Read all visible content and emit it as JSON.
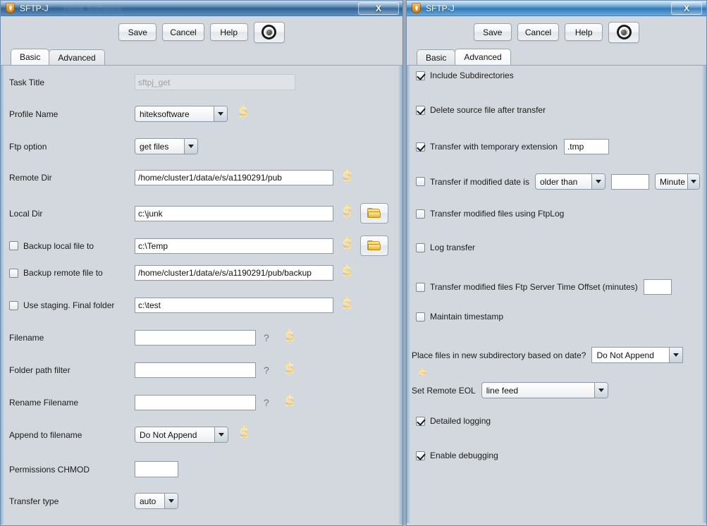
{
  "left_window": {
    "title": "SFTP-J",
    "watermark": "Hitek Software",
    "close_label": "X",
    "icon": "shield-icon",
    "toolbar": {
      "save": "Save",
      "cancel": "Cancel",
      "help": "Help",
      "settings_icon": "target-icon"
    },
    "tabs": [
      {
        "label": "Basic",
        "active": true
      },
      {
        "label": "Advanced",
        "active": false
      }
    ],
    "fields": {
      "task_title_label": "Task Title",
      "task_title_value": "sftpj_get",
      "profile_name_label": "Profile Name",
      "profile_name_value": "hiteksoftware",
      "ftp_option_label": "Ftp option",
      "ftp_option_value": "get files",
      "remote_dir_label": "Remote Dir",
      "remote_dir_value": "/home/cluster1/data/e/s/a1190291/pub",
      "local_dir_label": "Local Dir",
      "local_dir_value": "c:\\junk",
      "backup_local_label": "Backup local file to",
      "backup_local_value": "c:\\Temp",
      "backup_remote_label": "Backup remote file to",
      "backup_remote_value": "/home/cluster1/data/e/s/a1190291/pub/backup",
      "staging_label": "Use staging.  Final folder",
      "staging_value": "c:\\test",
      "filename_label": "Filename",
      "filename_value": "",
      "folder_path_filter_label": "Folder path filter",
      "folder_path_filter_value": "",
      "rename_filename_label": "Rename Filename",
      "rename_filename_value": "",
      "append_label": "Append to filename",
      "append_value": "Do Not Append",
      "chmod_label": "Permissions CHMOD",
      "chmod_value": "",
      "transfer_type_label": "Transfer type",
      "transfer_type_value": "auto",
      "help_marker": "?"
    }
  },
  "right_window": {
    "title": "SFTP-J",
    "close_label": "X",
    "icon": "shield-icon",
    "toolbar": {
      "save": "Save",
      "cancel": "Cancel",
      "help": "Help",
      "settings_icon": "target-icon"
    },
    "tabs": [
      {
        "label": "Basic",
        "active": false
      },
      {
        "label": "Advanced",
        "active": true
      }
    ],
    "options": {
      "include_subdirectories": "Include Subdirectories",
      "delete_source": "Delete source file after transfer",
      "temp_extension_label": "Transfer with temporary extension",
      "temp_extension_value": ".tmp",
      "modified_date_label": "Transfer if modified date is",
      "modified_date_compare": "older than",
      "modified_date_amount": "",
      "modified_date_unit": "Minute",
      "ftplog_label": "Transfer modified files using FtpLog",
      "log_transfer_label": "Log transfer",
      "time_offset_label": "Transfer modified files  Ftp Server Time Offset (minutes)",
      "time_offset_value": "",
      "maintain_timestamp_label": "Maintain timestamp",
      "subdirectory_date_label": "Place files in new subdirectory based on date?",
      "subdirectory_date_value": "Do Not Append",
      "remote_eol_label": "Set Remote EOL",
      "remote_eol_value": "line feed",
      "detailed_logging_label": "Detailed logging",
      "enable_debugging_label": "Enable debugging"
    }
  },
  "colors": {
    "titlebar_accent": "#3f74a5",
    "panel_bg": "#d3d8de",
    "field_border": "#8e99a5",
    "dollar_icon": "#e8b735",
    "folder_icon": "#e9b93c"
  }
}
